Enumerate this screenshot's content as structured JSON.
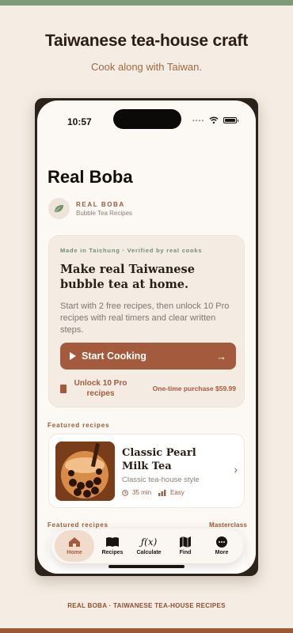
{
  "page": {
    "title": "Taiwanese tea-house craft",
    "subtitle": "Cook along with Taiwan.",
    "footer": "REAL BOBA · TAIWANESE TEA-HOUSE RECIPES"
  },
  "status_bar": {
    "time": "10:57"
  },
  "app": {
    "title": "Real Boba",
    "brand": {
      "name": "REAL BOBA",
      "tagline": "Bubble Tea Recipes"
    }
  },
  "hero_card": {
    "eyebrow": "Made in Taichung · Verified by real cooks",
    "heading": "Make real Taiwanese bubble tea at home.",
    "body": "Start with 2 free recipes, then unlock 10 Pro recipes with real timers and clear written steps.",
    "cta_label": "Start Cooking",
    "unlock_label": "Unlock 10 Pro recipes",
    "price_label": "One-time purchase $59.99"
  },
  "featured": {
    "section_label": "Featured recipes",
    "recipe": {
      "title": "Classic Pearl Milk Tea",
      "subtitle": "Classic tea-house style",
      "time": "35 min",
      "difficulty": "Easy"
    },
    "second_section_label": "Featured recipes",
    "second_section_right": "Masterclass"
  },
  "tabbar": {
    "tabs": [
      {
        "label": "Home",
        "icon": "home-icon",
        "active": true
      },
      {
        "label": "Recipes",
        "icon": "book-icon",
        "active": false
      },
      {
        "label": "Calculate",
        "icon": "function-icon",
        "active": false
      },
      {
        "label": "Find",
        "icon": "map-icon",
        "active": false
      },
      {
        "label": "More",
        "icon": "more-icon",
        "active": false
      }
    ]
  },
  "colors": {
    "accent": "#a45a3c",
    "background": "#f5ede3",
    "green": "#7f9a78"
  }
}
